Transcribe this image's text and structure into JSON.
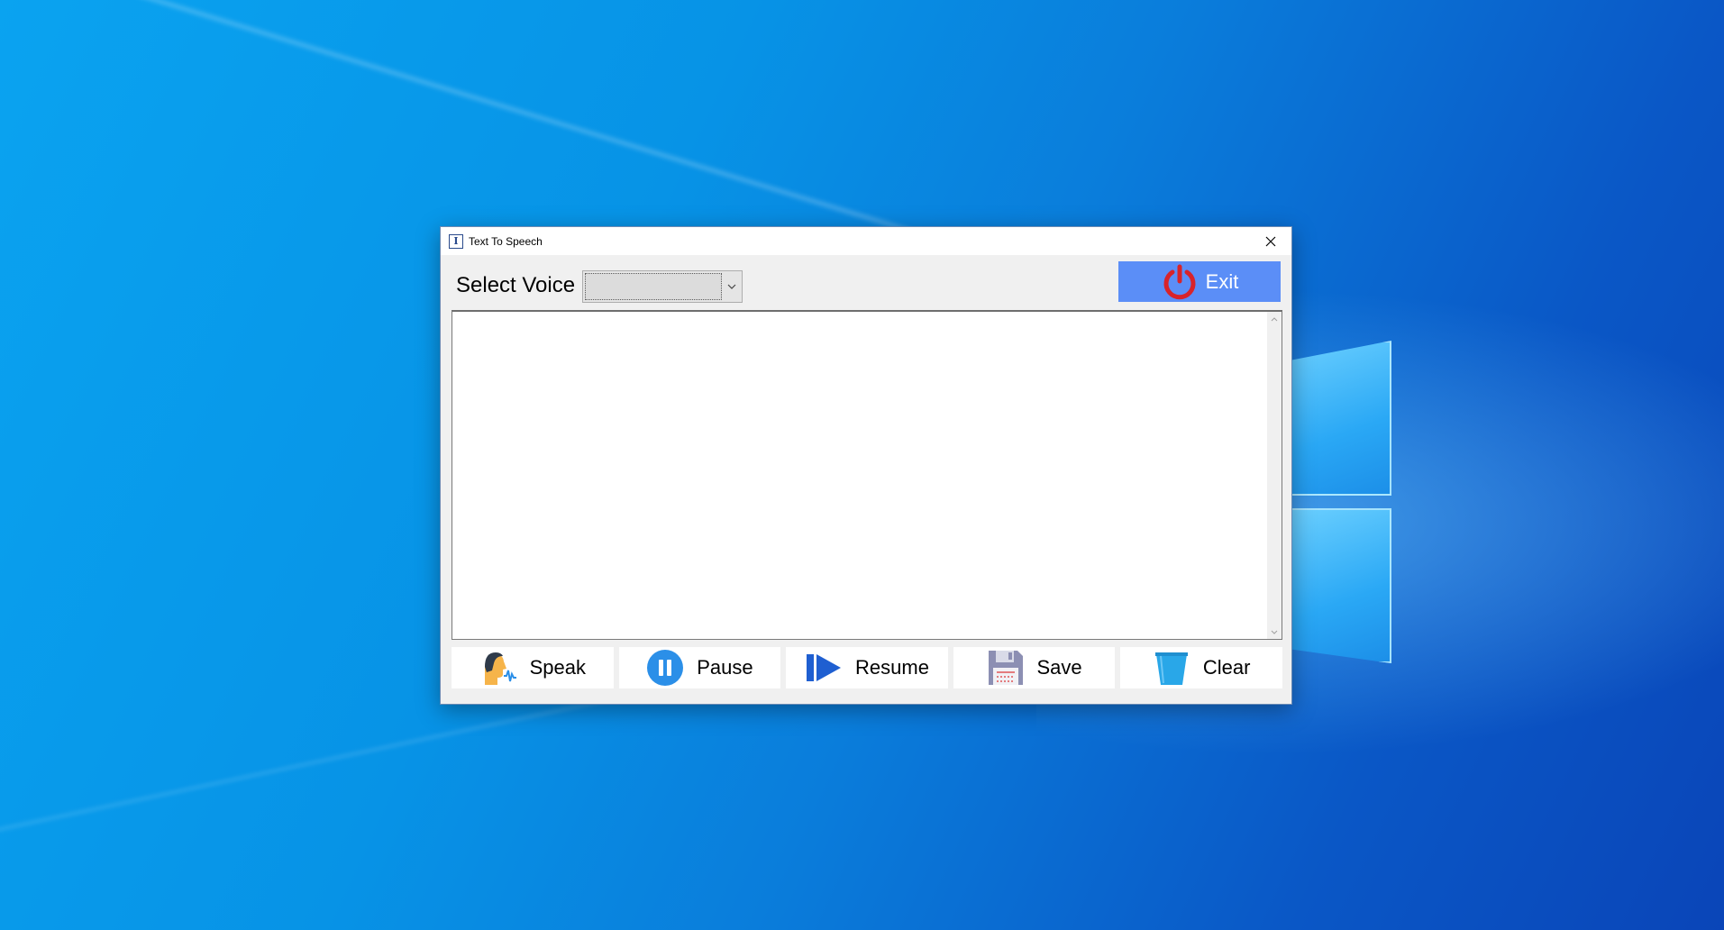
{
  "window": {
    "title": "Text To Speech",
    "app_icon_glyph": "I",
    "close_glyph": "✕"
  },
  "voice": {
    "label": "Select Voice",
    "selected": ""
  },
  "exit_button": {
    "label": "Exit",
    "icon": "power-icon",
    "color": "#5b8ef7"
  },
  "editor": {
    "text": ""
  },
  "actions": [
    {
      "label": "Speak",
      "icon": "speaking-head-icon"
    },
    {
      "label": "Pause",
      "icon": "pause-icon"
    },
    {
      "label": "Resume",
      "icon": "resume-icon"
    },
    {
      "label": "Save",
      "icon": "floppy-disk-icon"
    },
    {
      "label": "Clear",
      "icon": "trash-bin-icon"
    }
  ],
  "colors": {
    "accent": "#5b8ef7",
    "pause": "#2b8fe8",
    "resume": "#1f5fd1",
    "trash": "#29a7e8",
    "power": "#d8232a"
  }
}
